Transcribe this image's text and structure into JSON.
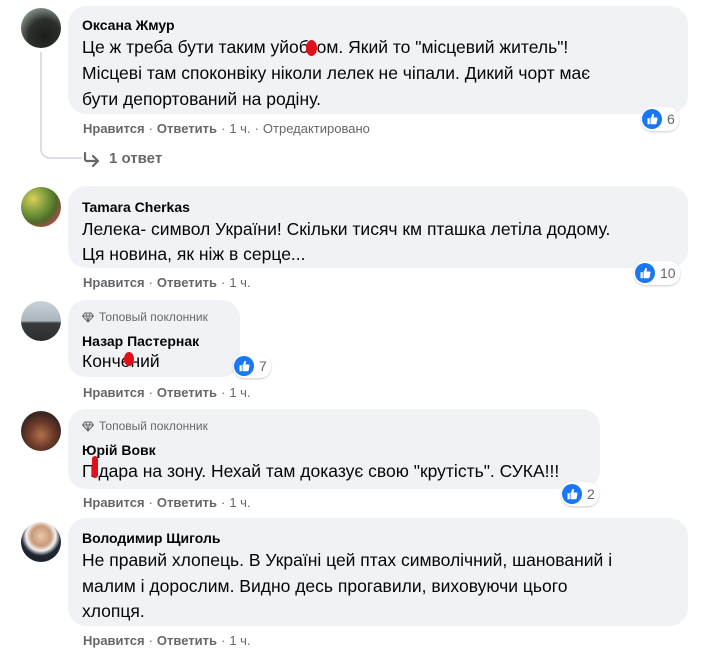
{
  "comments": [
    {
      "author": "Оксана Жмур",
      "lines": [
        "Це ж треба бути таким уйобком. Який то \"місцевий житель\"!",
        "Місцеві там споконвіку ніколи лелек не чіпали. Дикий чорт має",
        "бути депортований на родіну."
      ],
      "like": "Нравится",
      "reply": "Ответить",
      "time": "1 ч.",
      "edited": "Отредактировано",
      "reactions": "6"
    },
    {
      "author": "Tamara Cherkas",
      "lines": [
        "Лелека- символ України! Скільки тисяч км пташка летіла додому.",
        "Ця новина, як ніж в серце..."
      ],
      "like": "Нравится",
      "reply": "Ответить",
      "time": "1 ч.",
      "reactions": "10"
    },
    {
      "badge": "Топовый поклонник",
      "author": "Назар Пастернак",
      "lines": [
        "Кончений"
      ],
      "like": "Нравится",
      "reply": "Ответить",
      "time": "1 ч.",
      "reactions": "7"
    },
    {
      "badge": "Топовый поклонник",
      "author": "Юрій Вовк",
      "lines": [
        "Підара на зону. Нехай там доказує свою \"крутість\". СУКА!!!"
      ],
      "like": "Нравится",
      "reply": "Ответить",
      "time": "1 ч.",
      "reactions": "2"
    },
    {
      "author": "Володимир Щиголь",
      "lines": [
        "Не правий хлопець. В Україні цей птах символічний, шанований і",
        "малим і дорослим. Видно десь прогавили, виховуючи цього",
        "хлопця."
      ],
      "like": "Нравится",
      "reply": "Ответить",
      "time": "1 ч."
    }
  ],
  "replies_link": "1 ответ",
  "colors": {
    "bubble": "#f0f2f5",
    "like_blue": "#1877f2",
    "meta_gray": "#65676b",
    "red_mark": "#e0101a"
  },
  "icons": {
    "like": "like-thumb-icon",
    "reply_arrow": "reply-arrow-icon",
    "badge": "diamond-icon"
  }
}
